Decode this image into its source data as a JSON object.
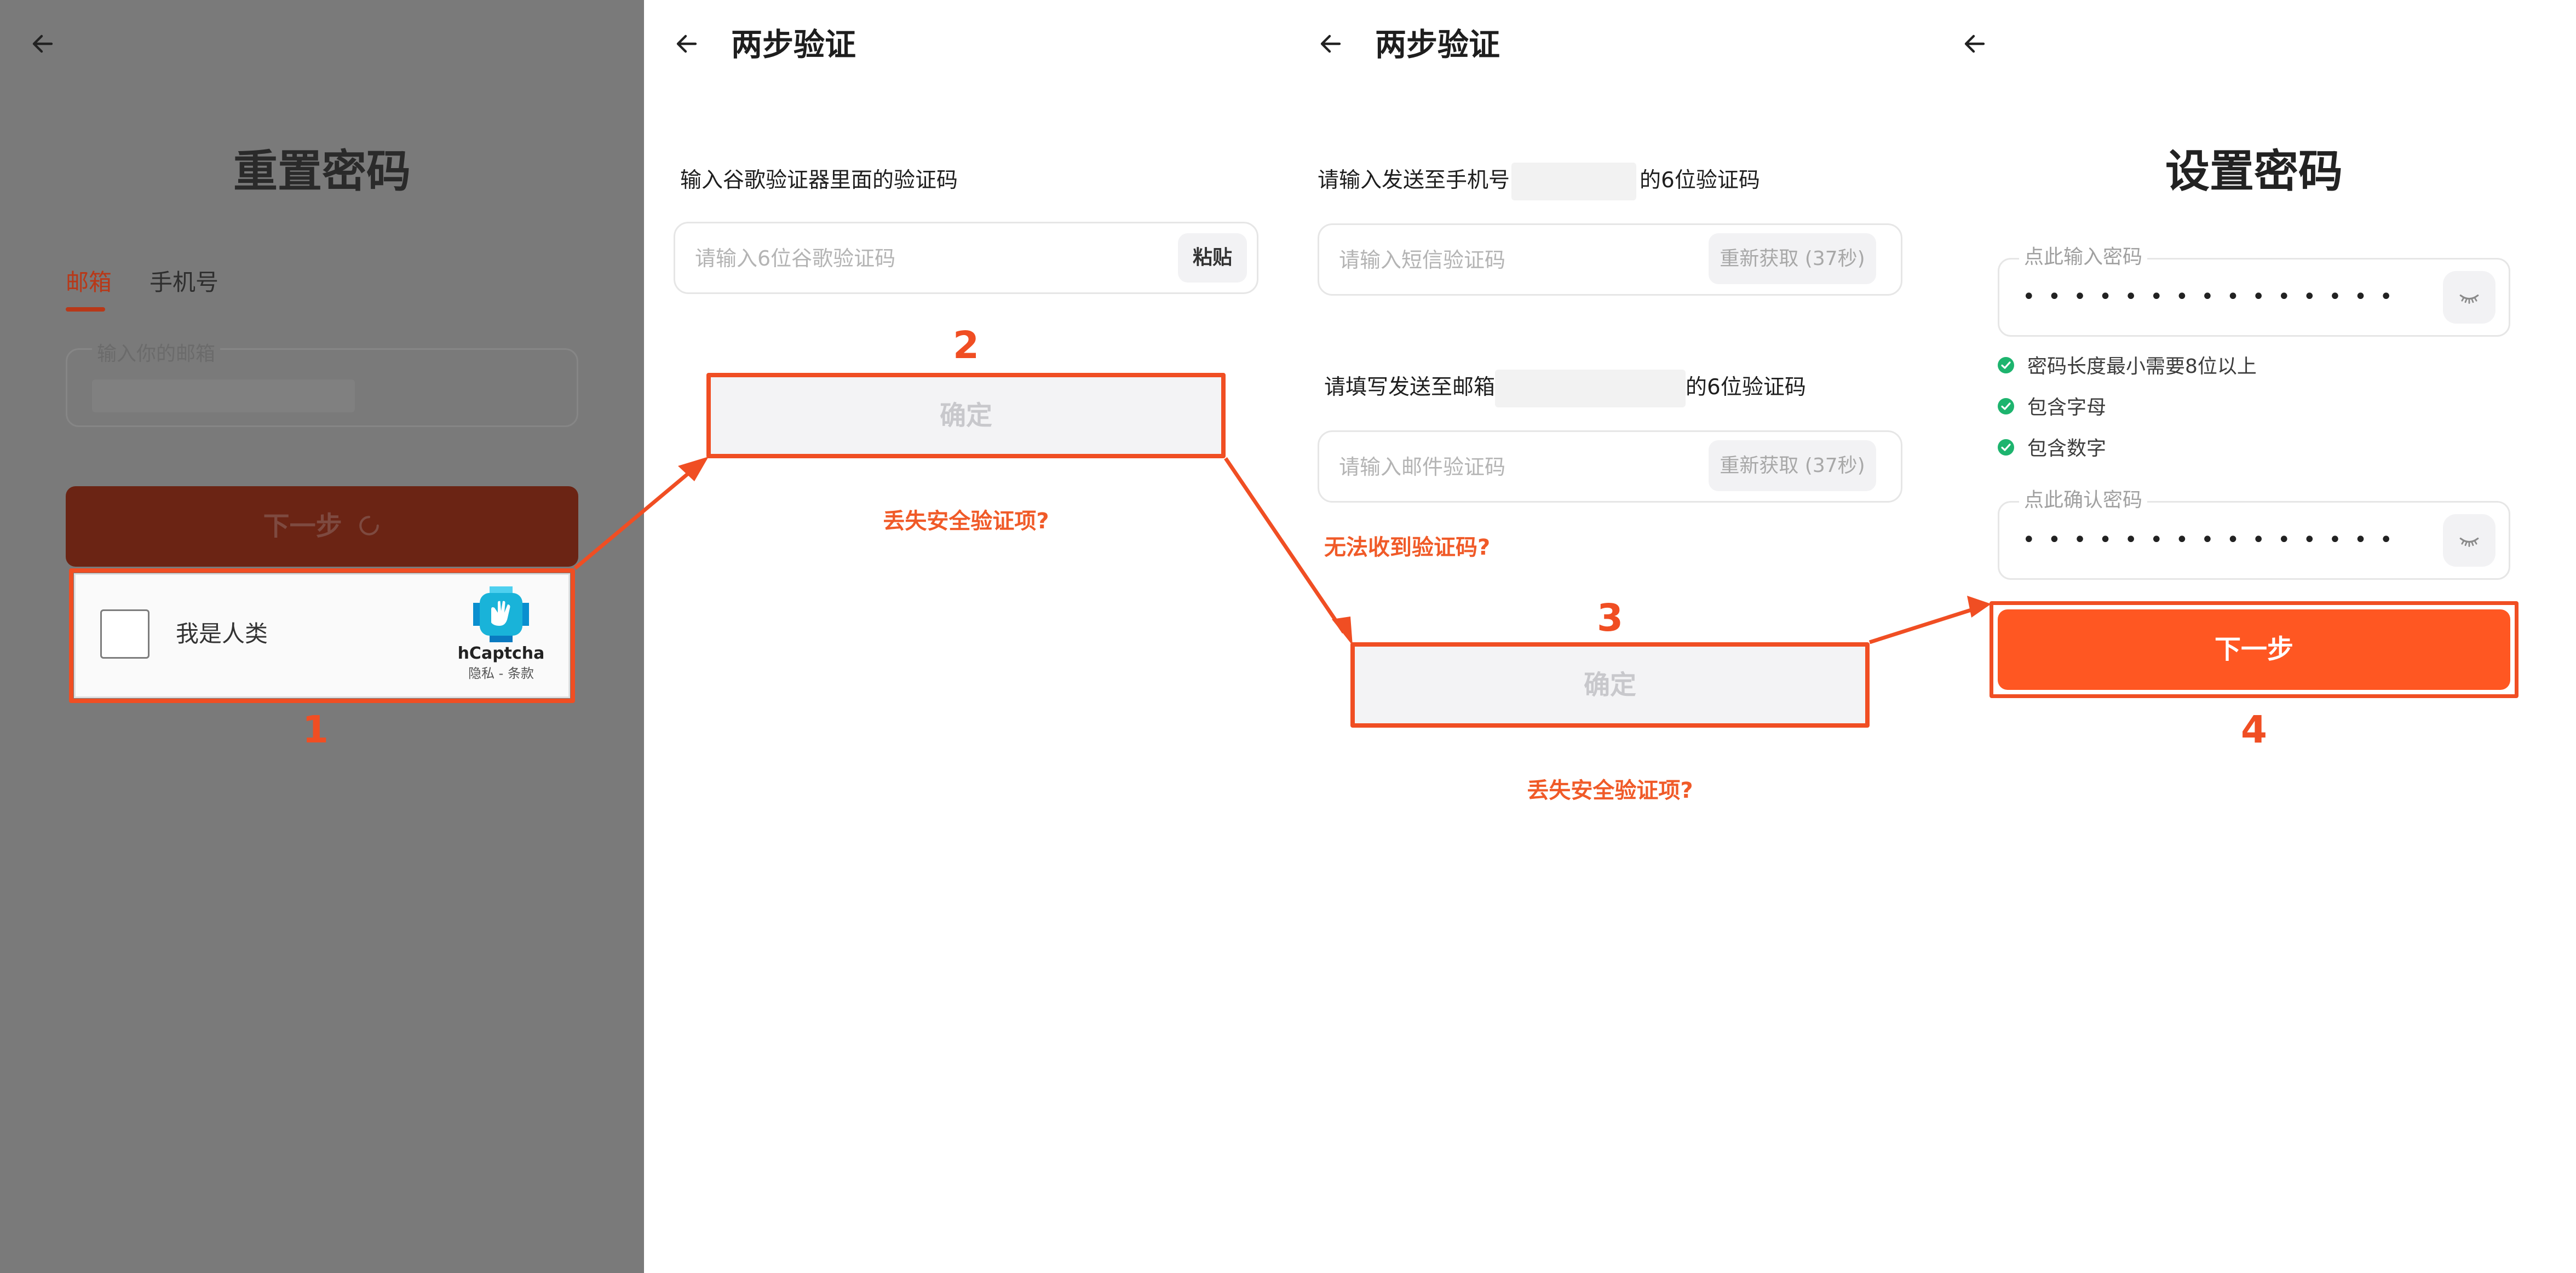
{
  "screen1": {
    "title": "重置密码",
    "tabs": [
      {
        "label": "邮箱",
        "active": true
      },
      {
        "label": "手机号",
        "active": false
      }
    ],
    "email_input": {
      "label": "输入你的邮箱",
      "value": ""
    },
    "next_button": {
      "label": "下一步"
    },
    "captcha": {
      "checkbox_label": "我是人类",
      "brand": "hCaptcha",
      "links": "隐私 - 条款"
    },
    "step_number": "1"
  },
  "screen2": {
    "title": "两步验证",
    "prompt": "输入谷歌验证器里面的验证码",
    "code_input": {
      "placeholder": "请输入6位谷歌验证码",
      "value": ""
    },
    "paste_button": "粘贴",
    "confirm_button": "确定",
    "lost_link": "丢失安全验证项?",
    "step_number": "2"
  },
  "screen3": {
    "title": "两步验证",
    "phone_prompt": {
      "before": "请输入发送至手机号",
      "after": "的6位验证码"
    },
    "sms_input": {
      "placeholder": "请输入短信验证码",
      "value": ""
    },
    "sms_resend": "重新获取 (37秒)",
    "email_prompt": {
      "before": "请填写发送至邮箱",
      "after": "的6位验证码"
    },
    "email_input": {
      "placeholder": "请输入邮件验证码",
      "value": ""
    },
    "email_resend": "重新获取 (37秒)",
    "no_code_link": "无法收到验证码?",
    "confirm_button": "确定",
    "lost_link": "丢失安全验证项?",
    "step_number": "3"
  },
  "screen4": {
    "title": "设置密码",
    "password_input": {
      "label": "点此输入密码",
      "value": "•••••••••••••••"
    },
    "rules": [
      "密码长度最小需要8位以上",
      "包含字母",
      "包含数字"
    ],
    "confirm_input": {
      "label": "点此确认密码",
      "value": "•••••••••••••••"
    },
    "next_button": "下一步",
    "step_number": "4"
  },
  "colors": {
    "accent": "#ff5722",
    "highlight_outline": "#f04e23",
    "overlay_gray": "#7a7a7a",
    "next_button_dimmed": "#6b2414",
    "check_green": "#1db46e"
  }
}
